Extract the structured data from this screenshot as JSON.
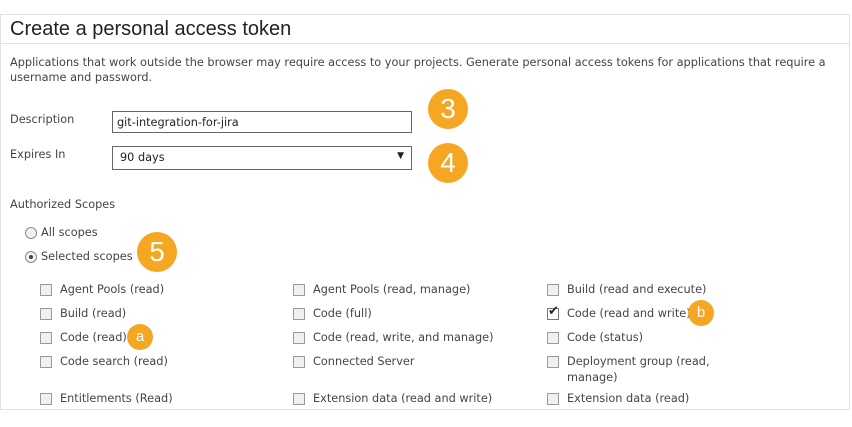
{
  "page": {
    "title": "Create a personal access token",
    "intro": "Applications that work outside the browser may require access to your projects. Generate personal access tokens for applications that require a username and password."
  },
  "form": {
    "description_label": "Description",
    "description_value": "git-integration-for-jira",
    "expires_label": "Expires In",
    "expires_value": "90 days",
    "scopes_label": "Authorized Scopes",
    "all_scopes": "All scopes",
    "selected_scopes": "Selected scopes",
    "selected_option": "Selected scopes"
  },
  "badges": {
    "b3": "3",
    "b4": "4",
    "b5": "5",
    "ba": "a",
    "bb": "b"
  },
  "colors": {
    "badge": "#f5a623"
  },
  "scopes": [
    {
      "label": "Agent Pools (read)",
      "checked": false
    },
    {
      "label": "Agent Pools (read, manage)",
      "checked": false
    },
    {
      "label": "Build (read and execute)",
      "checked": false
    },
    {
      "label": "Build (read)",
      "checked": false
    },
    {
      "label": "Code (full)",
      "checked": false
    },
    {
      "label": "Code (read and write)",
      "checked": true
    },
    {
      "label": "Code (read)",
      "checked": false
    },
    {
      "label": "Code (read, write, and manage)",
      "checked": false
    },
    {
      "label": "Code (status)",
      "checked": false
    },
    {
      "label": "Code search (read)",
      "checked": false
    },
    {
      "label": "Connected Server",
      "checked": false
    },
    {
      "label": "Deployment group (read, manage)",
      "checked": false
    },
    {
      "label": "Entitlements (Read)",
      "checked": false
    },
    {
      "label": "Extension data (read and write)",
      "checked": false
    },
    {
      "label": "Extension data (read)",
      "checked": false
    }
  ]
}
